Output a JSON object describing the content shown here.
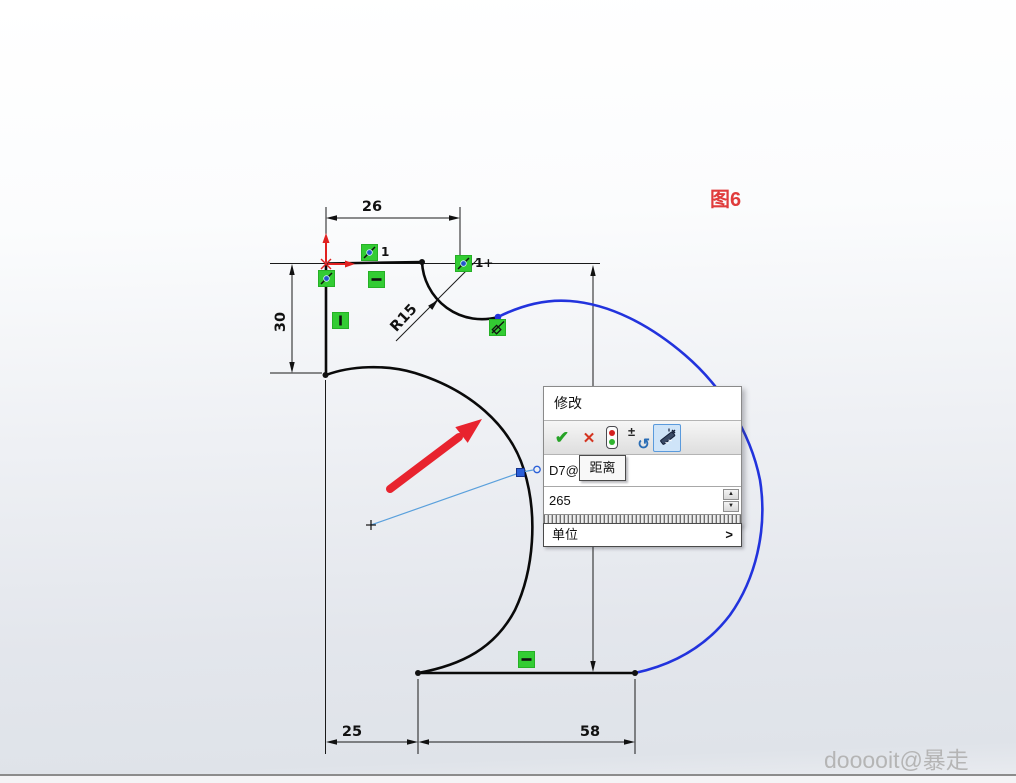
{
  "colors": {
    "relation-green": "#33cc33",
    "sketch-blue": "#2233dd",
    "annotation-red": "#e8232e",
    "figure-red": "#e03c3c",
    "leader-blue": "#5aa0dc",
    "watermark-gray": "#b5b5b5"
  },
  "figure": {
    "label": "图6"
  },
  "watermark": {
    "text": "dooooit@暴走"
  },
  "sketch": {
    "dimensions": {
      "top_width": "26",
      "left_height": "30",
      "bottom_left": "25",
      "bottom_right": "58",
      "fillet_radius": "R15"
    },
    "relations": {
      "coincident1_label": "1",
      "coincident2_label": "1+"
    },
    "icons": {
      "coincident": "green-square-diagonal-blue-dot",
      "horizontal": "green-square-horizontal-bar",
      "vertical": "green-square-vertical-bar",
      "tangent": "green-square-diamond-diagonal",
      "origin": "red-axes-arrows"
    }
  },
  "modify_dialog": {
    "title": "修改",
    "toolbar": {
      "accept": "✔",
      "cancel": "✕",
      "restore_pm": "±",
      "restore_arrow": "↺",
      "icons": {
        "accept": "check-icon",
        "cancel": "x-icon",
        "rebuild": "traffic-light-icon",
        "restore": "plus-minus-undo-icon",
        "spin_increment": "dimension-wand-icon"
      }
    },
    "name_value": "D7@",
    "tooltip": "距离",
    "value": "265",
    "spinner": {
      "up": "▲",
      "down": "▼"
    },
    "units": {
      "label": "单位",
      "expander": ">"
    }
  }
}
